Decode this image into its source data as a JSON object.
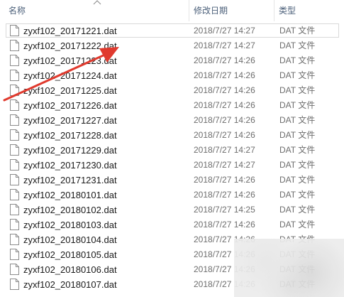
{
  "columns": {
    "name": "名称",
    "date_modified": "修改日期",
    "type": "类型"
  },
  "files": [
    {
      "name": "zyxf102_20171221.dat",
      "date": "2018/7/27 14:27",
      "type": "DAT 文件"
    },
    {
      "name": "zyxf102_20171222.dat",
      "date": "2018/7/27 14:27",
      "type": "DAT 文件"
    },
    {
      "name": "zyxf102_20171223.dat",
      "date": "2018/7/27 14:26",
      "type": "DAT 文件"
    },
    {
      "name": "zyxf102_20171224.dat",
      "date": "2018/7/27 14:26",
      "type": "DAT 文件"
    },
    {
      "name": "zyxf102_20171225.dat",
      "date": "2018/7/27 14:26",
      "type": "DAT 文件"
    },
    {
      "name": "zyxf102_20171226.dat",
      "date": "2018/7/27 14:26",
      "type": "DAT 文件"
    },
    {
      "name": "zyxf102_20171227.dat",
      "date": "2018/7/27 14:26",
      "type": "DAT 文件"
    },
    {
      "name": "zyxf102_20171228.dat",
      "date": "2018/7/27 14:26",
      "type": "DAT 文件"
    },
    {
      "name": "zyxf102_20171229.dat",
      "date": "2018/7/27 14:27",
      "type": "DAT 文件"
    },
    {
      "name": "zyxf102_20171230.dat",
      "date": "2018/7/27 14:27",
      "type": "DAT 文件"
    },
    {
      "name": "zyxf102_20171231.dat",
      "date": "2018/7/27 14:26",
      "type": "DAT 文件"
    },
    {
      "name": "zyxf102_20180101.dat",
      "date": "2018/7/27 14:26",
      "type": "DAT 文件"
    },
    {
      "name": "zyxf102_20180102.dat",
      "date": "2018/7/27 14:25",
      "type": "DAT 文件"
    },
    {
      "name": "zyxf102_20180103.dat",
      "date": "2018/7/27 14:26",
      "type": "DAT 文件"
    },
    {
      "name": "zyxf102_20180104.dat",
      "date": "2018/7/27 14:26",
      "type": "DAT 文件"
    },
    {
      "name": "zyxf102_20180105.dat",
      "date": "2018/7/27 14:26",
      "type": "DAT 文件"
    },
    {
      "name": "zyxf102_20180106.dat",
      "date": "2018/7/27 14:26",
      "type": "DAT 文件"
    },
    {
      "name": "zyxf102_20180107.dat",
      "date": "2018/7/27 14:26",
      "type": "DAT 文件"
    }
  ],
  "icons": {
    "file": "file-icon",
    "sort": "sort-up-icon",
    "annotation": "red-arrow-annotation"
  },
  "colors": {
    "header_text": "#4c607a",
    "date_text": "#6d6d6d",
    "name_text": "#1a1a1a",
    "selection_border": "#d9d9d9",
    "annotation_arrow": "#e03a2e"
  }
}
